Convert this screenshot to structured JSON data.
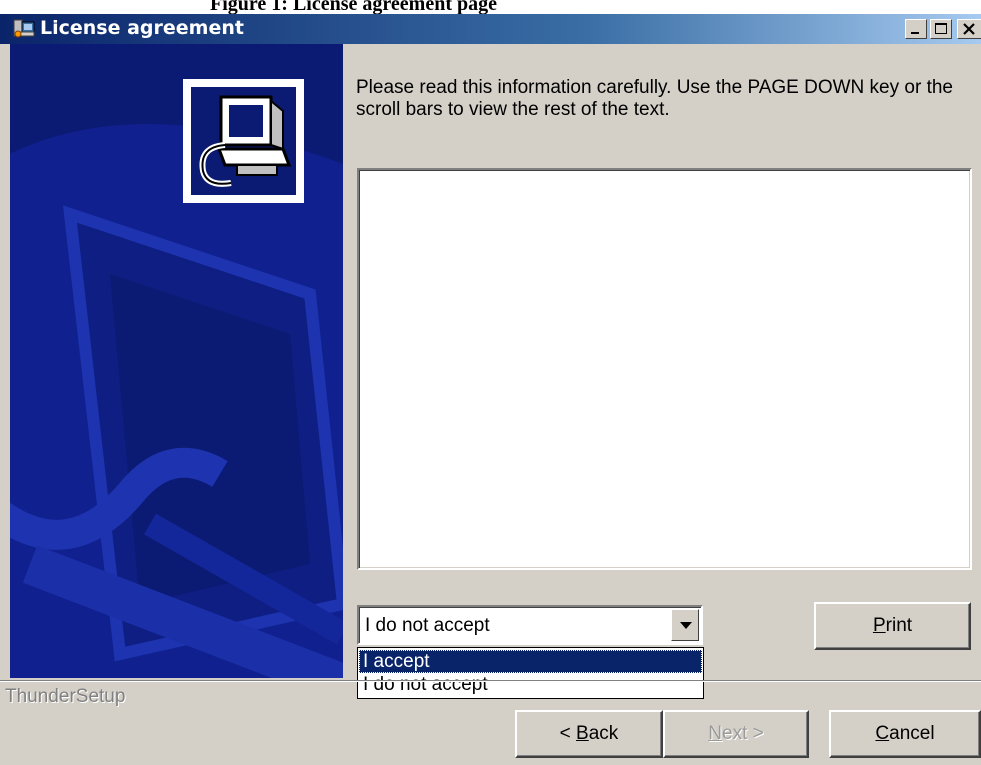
{
  "caption_above": "Figure 1: License agreement page",
  "window": {
    "title": "License agreement",
    "minimize_icon": "minimize-icon",
    "maximize_icon": "maximize-icon",
    "close_icon": "close-icon"
  },
  "banner": {
    "icon": "setup-computer-icon"
  },
  "content": {
    "instructions": "Please read this information carefully. Use the PAGE DOWN key or the scroll bars to view the rest of the text.",
    "license_text": ""
  },
  "accept_combo": {
    "selected_value": "I do not accept",
    "options": [
      "I accept",
      "I do not accept"
    ],
    "highlighted_option": "I accept"
  },
  "buttons": {
    "print": {
      "pre": "",
      "key": "P",
      "post": "rint"
    },
    "back": {
      "pre": "< ",
      "key": "B",
      "post": "ack"
    },
    "next": {
      "pre": "",
      "key": "N",
      "post": "ext >"
    },
    "cancel": {
      "pre": "",
      "key": "C",
      "post": "ancel"
    }
  },
  "footer": {
    "brand": "ThunderSetup"
  },
  "colors": {
    "titlebar_start": "#0a246a",
    "titlebar_end": "#a6caf0",
    "face": "#d4d0c8",
    "banner": "#0b1a72",
    "selection": "#0a246a"
  }
}
